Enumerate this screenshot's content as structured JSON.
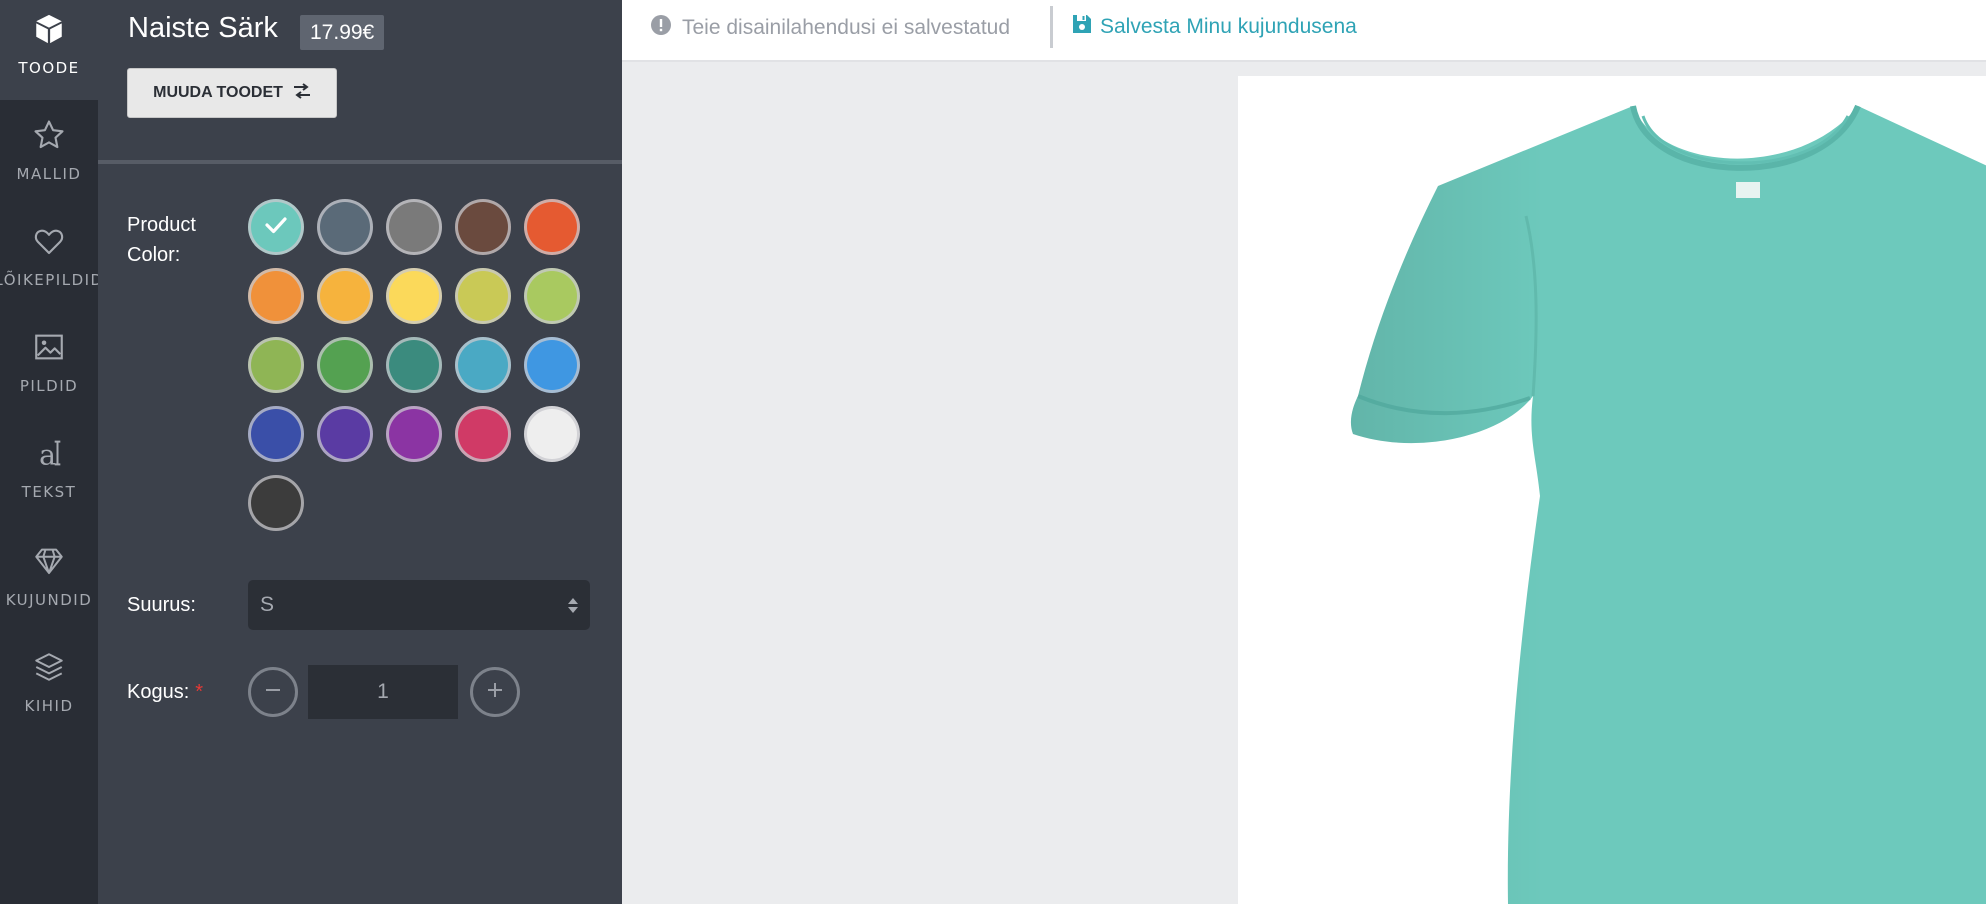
{
  "nav": {
    "items": [
      {
        "label": "TOODE",
        "icon": "box-icon",
        "active": true
      },
      {
        "label": "MALLID",
        "icon": "star-icon",
        "active": false
      },
      {
        "label": "LÕIKEPILDID",
        "icon": "heart-icon",
        "active": false
      },
      {
        "label": "PILDID",
        "icon": "image-icon",
        "active": false
      },
      {
        "label": "TEKST",
        "icon": "text-icon",
        "active": false
      },
      {
        "label": "KUJUNDID",
        "icon": "diamond-icon",
        "active": false
      },
      {
        "label": "KIHID",
        "icon": "layers-icon",
        "active": false
      }
    ]
  },
  "product": {
    "title": "Naiste Särk",
    "price": "17.99€",
    "change_button": "MUUDA TOODET",
    "color_label": "Product Color:",
    "colors": [
      "#6cc8bc",
      "#5a6a78",
      "#7a7a7a",
      "#6a4a3e",
      "#e55a31",
      "#f0913a",
      "#f6b33d",
      "#fbd95a",
      "#c9c956",
      "#a9c960",
      "#8fb555",
      "#54a151",
      "#3b8b7e",
      "#4aa9c4",
      "#3f97e2",
      "#3a4fa8",
      "#5a3ba3",
      "#8b34a3",
      "#d03a66",
      "#eeeeee",
      "#3c3c3c"
    ],
    "selected_color_index": 0,
    "size_label": "Suurus:",
    "size_value": "S",
    "quantity_label": "Kogus:",
    "quantity_required_mark": "*",
    "quantity_value": "1"
  },
  "topbar": {
    "unsaved_text": "Teie disainilahendusi ei salvestatud",
    "save_link": "Salvesta Minu kujundusena"
  },
  "canvas": {
    "shirt_color": "#6dc9bc"
  }
}
